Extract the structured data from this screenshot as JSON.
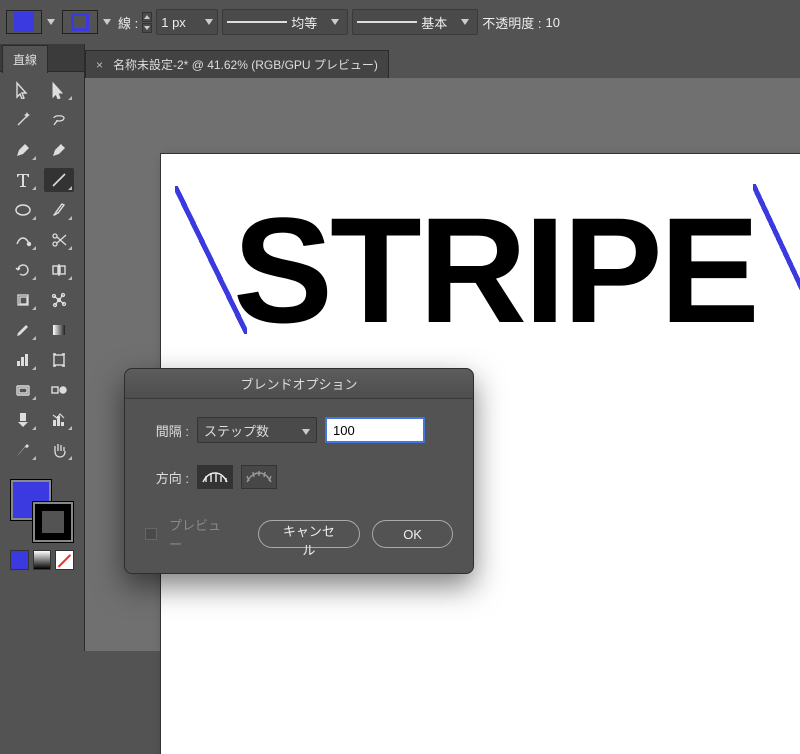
{
  "tool_panel_tab": "直線",
  "topbar": {
    "stroke_label": "線 :",
    "stroke_width": "1 px",
    "dash_label": "均等",
    "profile_label": "基本",
    "opacity_label": "不透明度 :",
    "opacity_value": "10",
    "fill_color": "#3a3ae0",
    "stroke_color": "#3a3ae0"
  },
  "document": {
    "tab_title": "名称未設定-2* @ 41.62% (RGB/GPU プレビュー)",
    "artboard_text": "STRIPE"
  },
  "dialog": {
    "title": "ブレンドオプション",
    "spacing_label": "間隔 :",
    "spacing_mode": "ステップ数",
    "spacing_value": "100",
    "orientation_label": "方向 :",
    "preview_label": "プレビュー",
    "cancel": "キャンセル",
    "ok": "OK"
  }
}
